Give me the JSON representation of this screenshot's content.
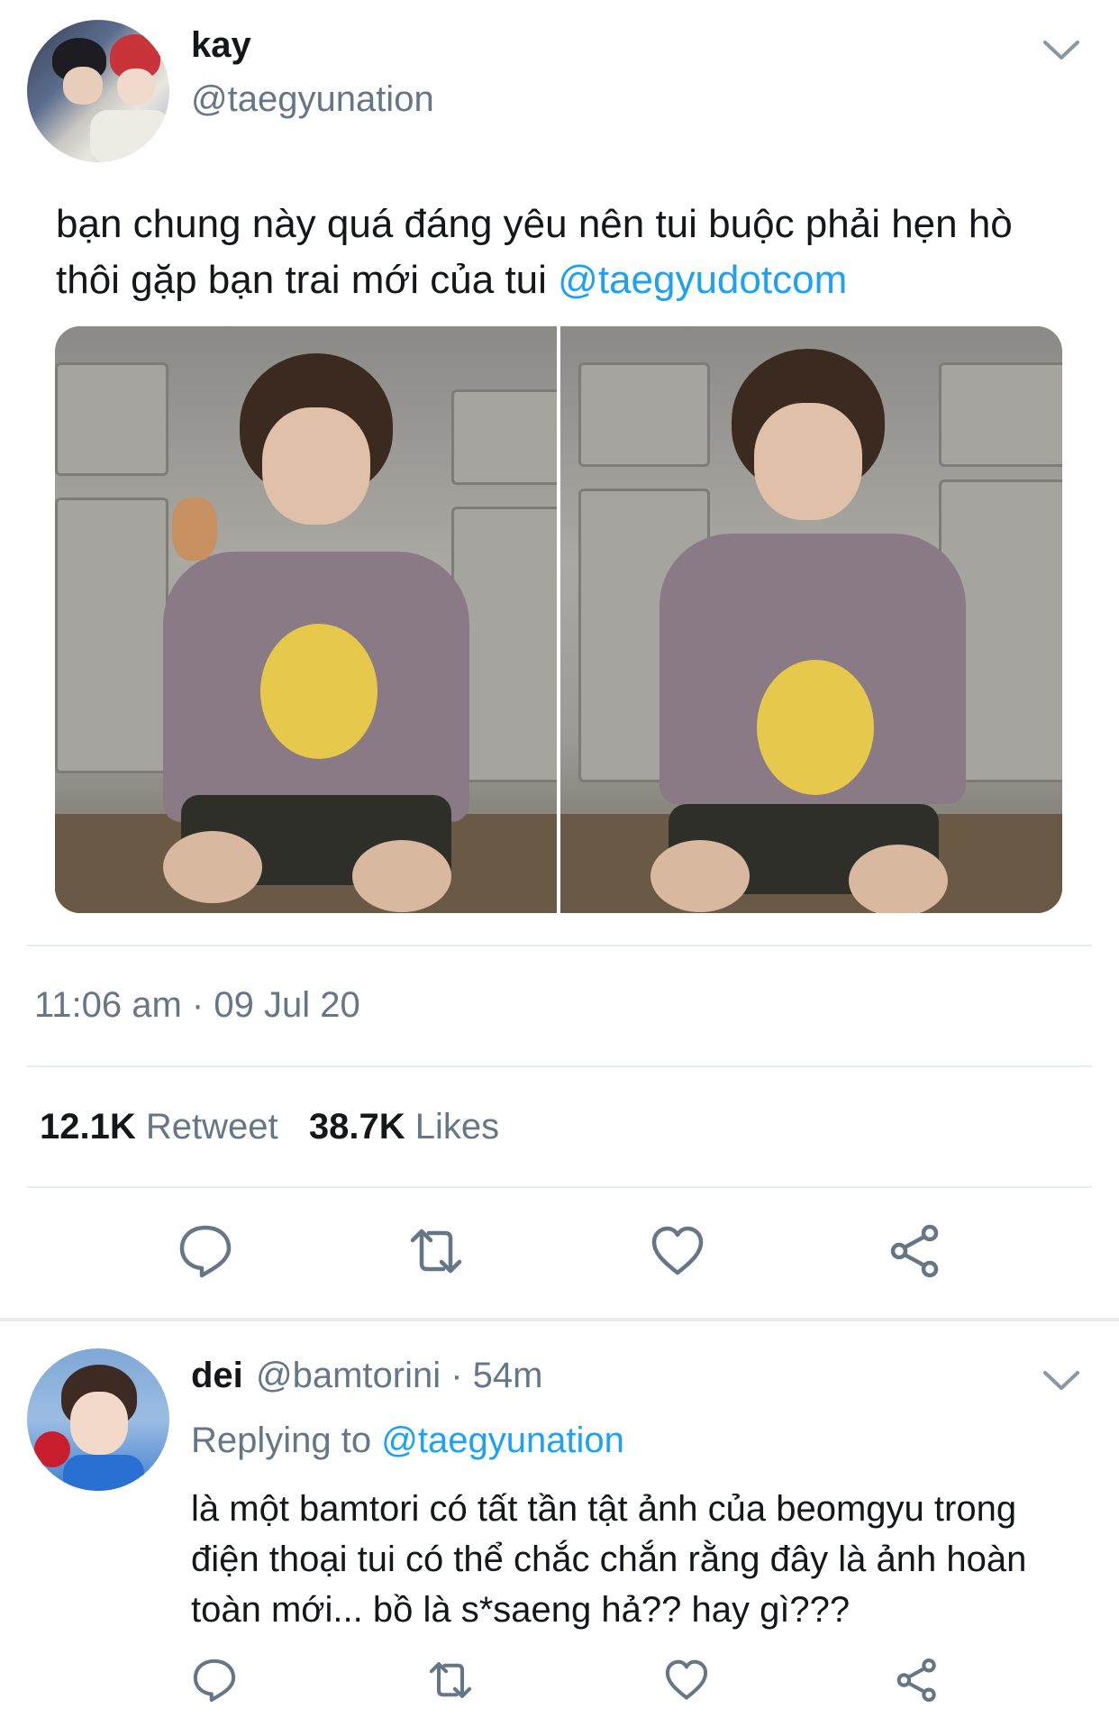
{
  "tweet": {
    "author_name": "kay",
    "author_handle": "@taegyunation",
    "text_before_mention": "bạn chung này quá đáng yêu nên tui buộc phải hẹn hò thôi gặp bạn trai mới của tui ",
    "mention": "@taegyudotcom",
    "timestamp": "11:06 am · 09 Jul 20",
    "retweet_count": "12.1K",
    "retweet_label": "Retweet",
    "likes_count": "38.7K",
    "likes_label": "Likes"
  },
  "reply": {
    "author_name": "dei",
    "meta": "@bamtorini · 54m",
    "replying_prefix": "Replying to ",
    "replying_handle": "@taegyunation",
    "text": "là một bamtori có tất tần tật ảnh của beomgyu trong điện thoại tui có thể chắc chắn rằng đây là ảnh hoàn toàn mới... bồ là s*saeng hả?? hay gì???"
  },
  "icons": [
    "chevron-down-icon",
    "reply-icon",
    "retweet-icon",
    "like-icon",
    "share-icon"
  ],
  "colors": {
    "link": "#1da1f2",
    "secondary_text": "#657786",
    "icon": "#657786",
    "divider": "#e6ecf0"
  }
}
